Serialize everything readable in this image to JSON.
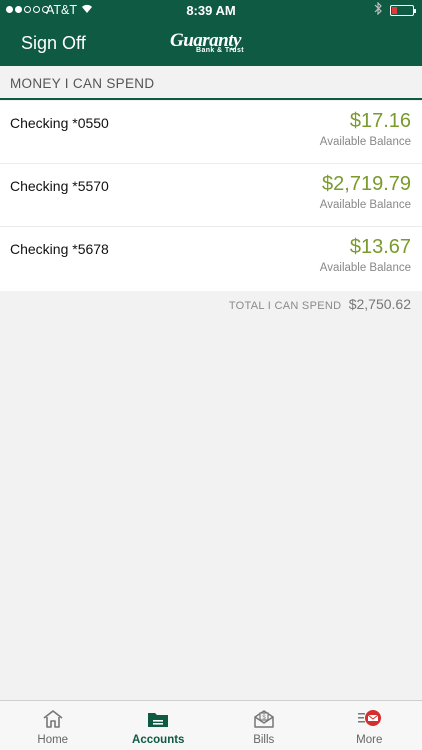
{
  "status_bar": {
    "carrier": "AT&T",
    "time": "8:39 AM"
  },
  "nav": {
    "sign_off_label": "Sign Off",
    "logo_main": "Guaranty",
    "logo_sub": "Bank & Trust"
  },
  "section": {
    "title": "MONEY I CAN SPEND"
  },
  "accounts": [
    {
      "name": "Checking *0550",
      "amount": "$17.16",
      "label": "Available Balance"
    },
    {
      "name": "Checking *5570",
      "amount": "$2,719.79",
      "label": "Available Balance"
    },
    {
      "name": "Checking *5678",
      "amount": "$13.67",
      "label": "Available Balance"
    }
  ],
  "total": {
    "label": "TOTAL I CAN SPEND",
    "value": "$2,750.62"
  },
  "tabs": [
    {
      "label": "Home",
      "icon": "home-icon"
    },
    {
      "label": "Accounts",
      "icon": "folder-icon",
      "active": true
    },
    {
      "label": "Bills",
      "icon": "bill-envelope-icon"
    },
    {
      "label": "More",
      "icon": "mail-notification-icon"
    }
  ],
  "colors": {
    "brand_green": "#0f5a43",
    "amount_green": "#7a9a2e",
    "badge_red": "#d32f2f"
  }
}
